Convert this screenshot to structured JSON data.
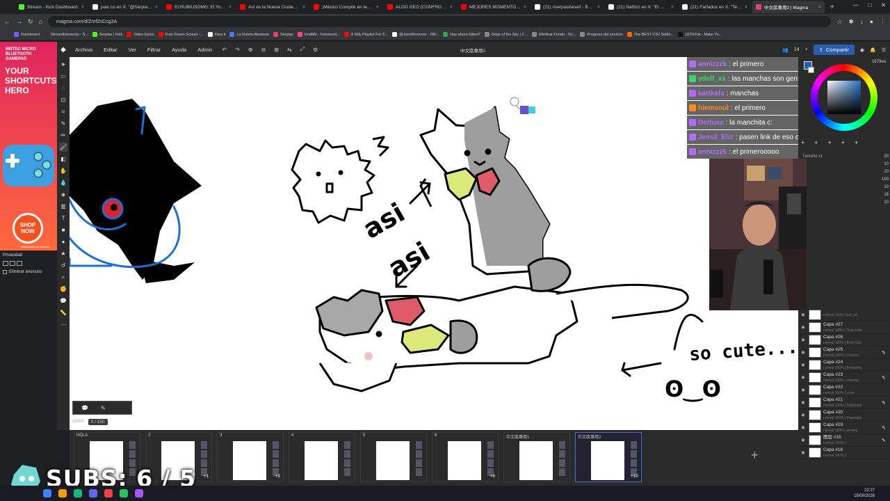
{
  "browser": {
    "tabs": [
      {
        "label": "Stream - Kick Dashboard",
        "color": "#53fc18"
      },
      {
        "label": "paw co en X: \"@Serpias h",
        "color": "#ffffff"
      },
      {
        "label": "ELRUBIUSOMG: El YouTub",
        "color": "#ff0000"
      },
      {
        "label": "Así es la Nueva Ciudad P",
        "color": "#ff0000"
      },
      {
        "label": "¡México Compite en las E",
        "color": "#ff0000"
      },
      {
        "label": "ALDO GEO (CONFRONTA",
        "color": "#ff0000"
      },
      {
        "label": "MEJORES MOMENTOS IB",
        "color": "#ff0000"
      },
      {
        "label": "(21) #serpiasfanart - Busc",
        "color": "#ffffff"
      },
      {
        "label": "(21) Nathzz en X: \"El mag",
        "color": "#ffffff"
      },
      {
        "label": "(21) Farfadox en X: \"Tene",
        "color": "#ffffff"
      },
      {
        "label": "中文區專用2 | Magma",
        "color": "#e8426a",
        "active": true
      }
    ],
    "new_tab": "+",
    "url": "magma.com/d/Zmf2nCcg2A",
    "bookmarks": [
      {
        "label": "Dashboard",
        "color": "#7b5cff"
      },
      {
        "label": "StreamElements - S...",
        "color": "#333333"
      },
      {
        "label": "Serpias | Kick",
        "color": "#53fc18"
      },
      {
        "label": "Video Epico",
        "color": "#ff0000"
      },
      {
        "label": "Free Green Screen -...",
        "color": "#ff0000"
      },
      {
        "label": "Para ti",
        "color": "#ffffff"
      },
      {
        "label": "La Ruleta Aleatoria",
        "color": "#3b82f6"
      },
      {
        "label": "Serpias",
        "color": "#e8426a"
      },
      {
        "label": "GrafMe - Fotomont...",
        "color": "#ff4081"
      },
      {
        "label": "A Silly Playlist For S...",
        "color": "#ff0000"
      },
      {
        "label": "@JaneRemover - OB...",
        "color": "#ffffff"
      },
      {
        "label": "Hay ahora fútbol?",
        "color": "#22aa44"
      },
      {
        "label": "Dege of the Sky | C...",
        "color": "#888888"
      },
      {
        "label": "Eliminar Fondo - Su...",
        "color": "#888888"
      },
      {
        "label": "Progreso del servicio",
        "color": "#888888"
      },
      {
        "label": "The BEST CS2 Settin...",
        "color": "#ff6600"
      },
      {
        "label": "(3)TikTok - Make Yo...",
        "color": "#111111"
      }
    ]
  },
  "ad": {
    "top_text": "8BITDO MICRO BLUETOOTH GAMEPAD",
    "headline": "YOUR SHORTCUTS HERO",
    "cta": "SHOP NOW",
    "small": "Información de anuncio",
    "privacy": "Privacidad",
    "remove": "Eliminar anuncios"
  },
  "menu": {
    "items": [
      "Archivo",
      "Editar",
      "Ver",
      "Filtrar",
      "Ayuda",
      "Admin"
    ],
    "doc_title": "中文區專用2",
    "user_count": "14",
    "share": "Compartir"
  },
  "chat": [
    {
      "user": "annizzzk",
      "text": ": el primero",
      "color": "#b36bff"
    },
    {
      "user": "ydelf_xx",
      "text": ": las manchas son geniales",
      "color": "#3fd46a"
    },
    {
      "user": "kattkafa",
      "text": ": manchas",
      "color": "#b36bff"
    },
    {
      "user": "hiemsoul",
      "text": ": el primero",
      "color": "#ff8c1a"
    },
    {
      "user": "Derluxx",
      "text": ": la manchita c:",
      "color": "#b36bff"
    },
    {
      "user": "Jess3_Eliz",
      "text": ": pasen link de eso chat",
      "color": "#b36bff"
    },
    {
      "user": "annizzzk",
      "text": ": el primerooooo",
      "color": "#b36bff"
    }
  ],
  "canvas": {
    "text_asi_1": "asi",
    "text_asi_2": "asi",
    "text_so_cute": "so cute...",
    "text_eyes": "ʘ‿ʘ"
  },
  "zoom": {
    "percent": "328%",
    "frame": "0 / 150"
  },
  "right_panel": {
    "size_readout": "1679ea",
    "tam_label": "Tamaño x1",
    "brush_sizes": [
      "20",
      "10",
      "20",
      "100",
      "10",
      "18",
      "10"
    ]
  },
  "layers": [
    {
      "name": "",
      "meta": "normal 100% | bot_ad"
    },
    {
      "name": "Capa #27",
      "meta": "normal 100% | Yegn Elite"
    },
    {
      "name": "Capa #26",
      "meta": "normal 100% | Bello Cirit"
    },
    {
      "name": "Capa #25",
      "meta": "normal 100% | Chance",
      "pen": true
    },
    {
      "name": "Capa #24",
      "meta": "normal 100% | thinkabou"
    },
    {
      "name": "Capa #23",
      "meta": "normal 100% | mirvusa",
      "pen": true
    },
    {
      "name": "Capa #22",
      "meta": "normal 100% | vyvio"
    },
    {
      "name": "Capa #21",
      "meta": "normal 100% | Pawastak",
      "pen": true
    },
    {
      "name": "Capa #20",
      "meta": "normal 100% | Pawastak"
    },
    {
      "name": "Capa #19",
      "meta": "normal 100% | serviez",
      "pen": true
    },
    {
      "name": "图层 #15",
      "meta": "normal 100% | ·",
      "pen": true
    },
    {
      "name": "Capa #16",
      "meta": "normal 100% | ·"
    }
  ],
  "pages": [
    {
      "num": "HOLA",
      "badge": ""
    },
    {
      "num": "2",
      "badge": "+1"
    },
    {
      "num": "3",
      "badge": "+2"
    },
    {
      "num": "4",
      "badge": ""
    },
    {
      "num": "5",
      "badge": ""
    },
    {
      "num": "6",
      "badge": "+4"
    },
    {
      "num": "中文區專用1",
      "badge": ""
    },
    {
      "num": "中文區專用2",
      "badge": "+10",
      "active": true
    }
  ],
  "overlay": {
    "subs": "SUBS: 6 / 5"
  },
  "taskbar": {
    "time": "22:27",
    "date": "15/08/2026"
  }
}
